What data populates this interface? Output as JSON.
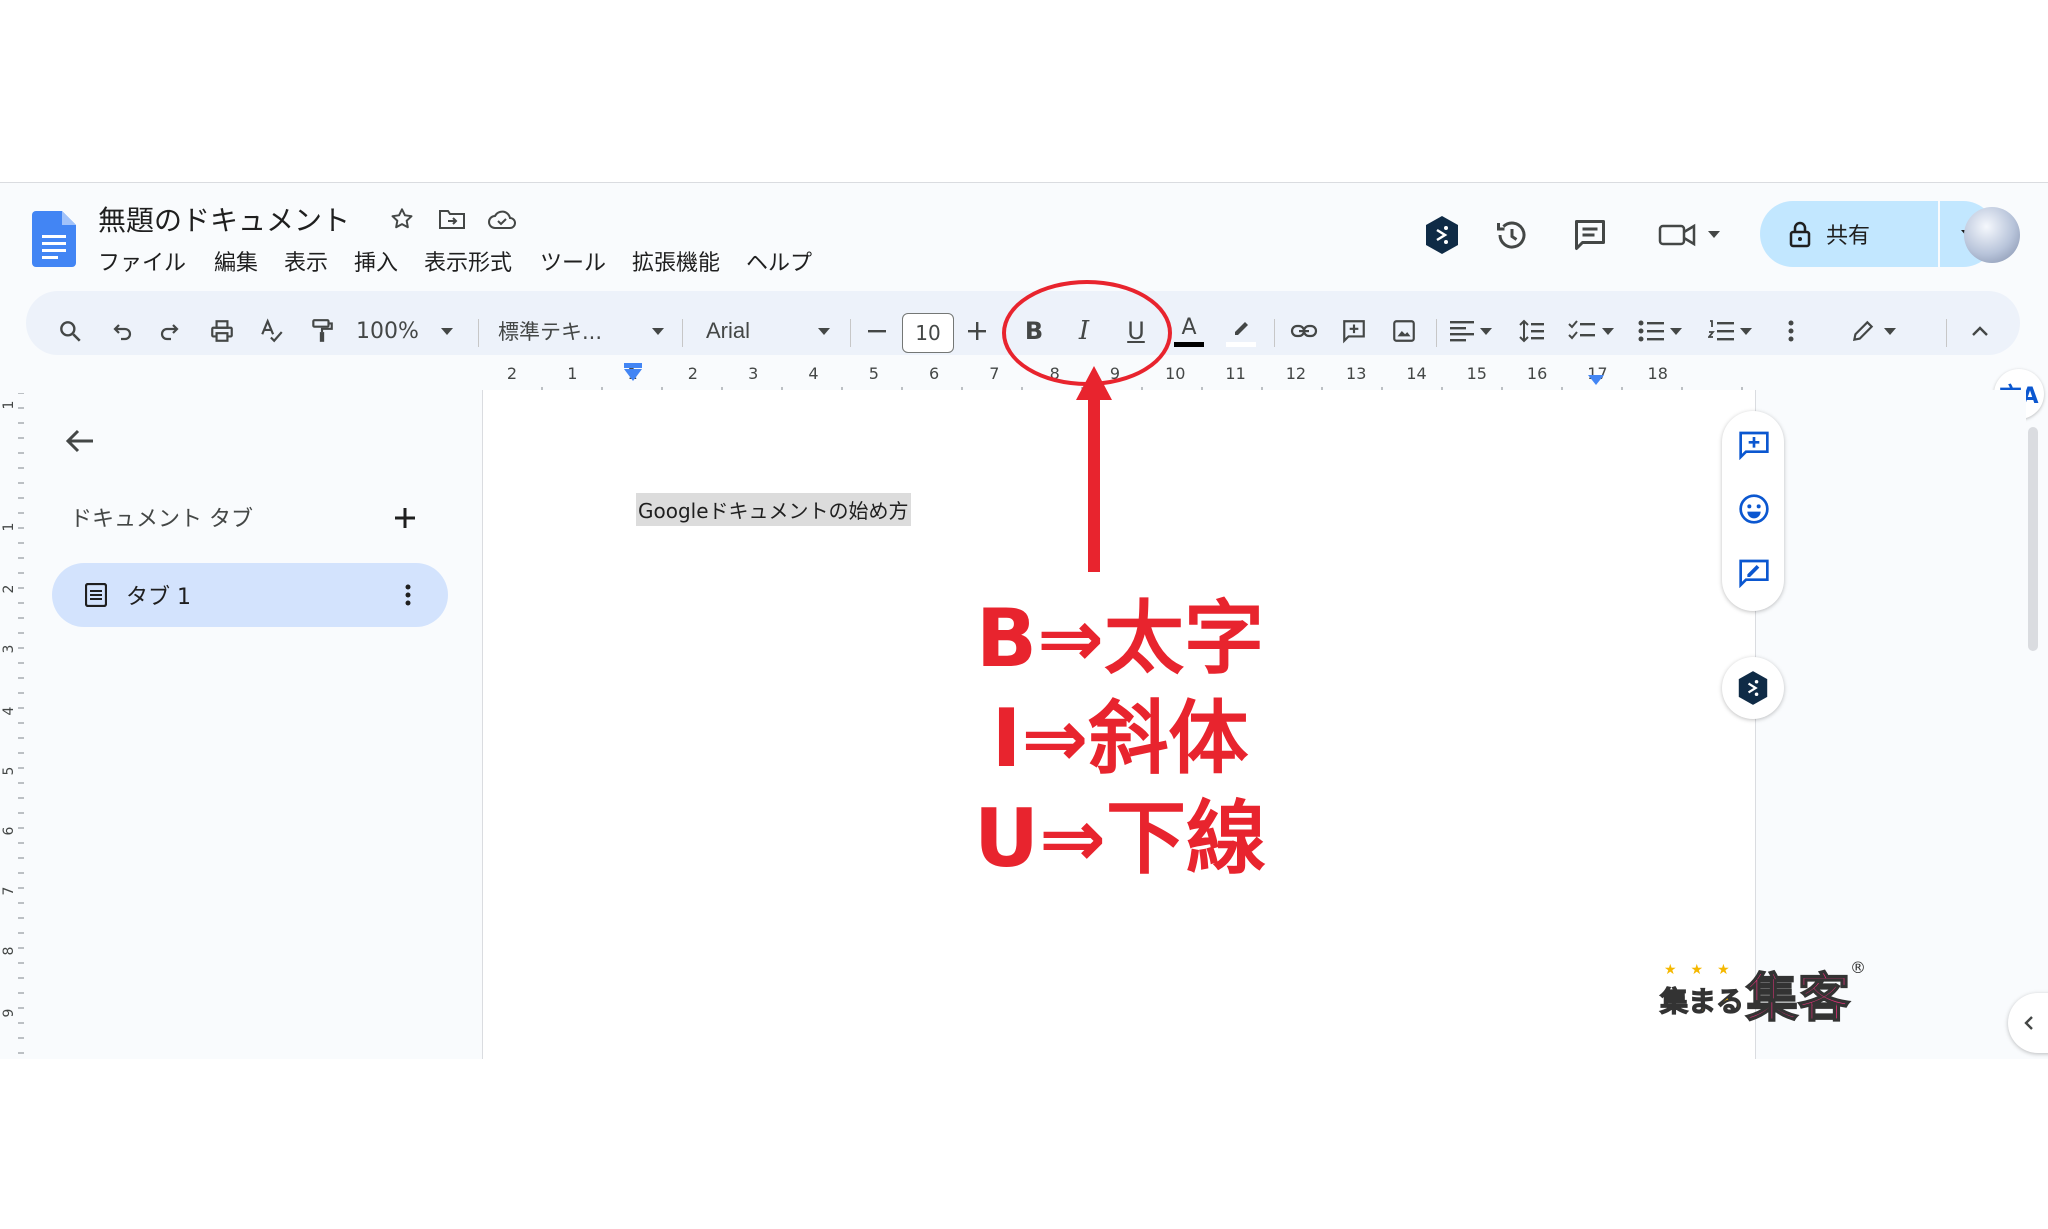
{
  "doc": {
    "title": "無題のドキュメント",
    "menus": [
      "ファイル",
      "編集",
      "表示",
      "挿入",
      "表示形式",
      "ツール",
      "拡張機能",
      "ヘルプ"
    ],
    "share_label": "共有"
  },
  "toolbar": {
    "zoom": "100%",
    "style": "標準テキ...",
    "font": "Arial",
    "font_size": "10",
    "bold": "B",
    "italic": "I",
    "underline": "U",
    "text_color": "A"
  },
  "ruler": {
    "h_labels": [
      "2",
      "1",
      "1",
      "2",
      "3",
      "4",
      "5",
      "6",
      "7",
      "8",
      "9",
      "10",
      "11",
      "12",
      "13",
      "14",
      "15",
      "16",
      "17",
      "18"
    ],
    "v_labels": [
      "1",
      "1",
      "2",
      "3",
      "4",
      "5",
      "6",
      "7",
      "8",
      "9"
    ]
  },
  "sidebar": {
    "title": "ドキュメント タブ",
    "tab_label": "タブ 1"
  },
  "page": {
    "text": "Googleドキュメントの始め方"
  },
  "annotation": {
    "lines": [
      "B⇒太字",
      "I⇒斜体",
      "U⇒下線"
    ],
    "color": "#e8242e"
  },
  "logo": {
    "text_small": "集まる",
    "text_big": "集客",
    "mark": "®"
  },
  "colors": {
    "accent": "#c2e7ff",
    "docs_blue": "#4285f4",
    "tab_selected": "#d3e3fd"
  }
}
